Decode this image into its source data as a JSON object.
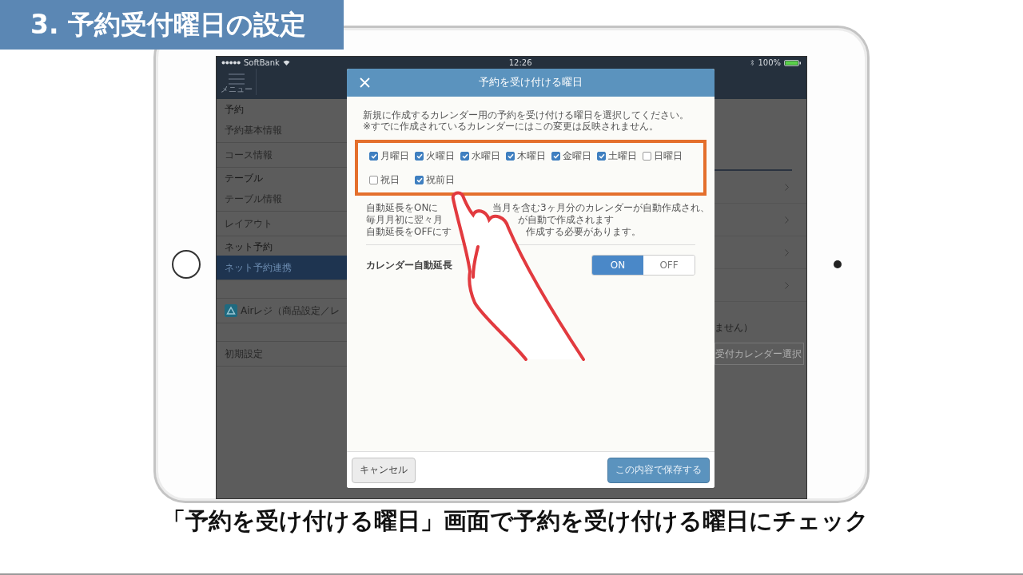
{
  "banner": {
    "title": "3. 予約受付曜日の設定"
  },
  "status_bar": {
    "carrier": "SoftBank",
    "time": "12:26",
    "battery": "100%"
  },
  "nav": {
    "menu_label": "メニュー"
  },
  "sidebar": {
    "items": [
      {
        "kind": "header",
        "label": "予約"
      },
      {
        "kind": "item",
        "label": "予約基本情報",
        "selected": false
      },
      {
        "kind": "item",
        "label": "コース情報",
        "selected": false
      },
      {
        "kind": "header",
        "label": "テーブル"
      },
      {
        "kind": "item",
        "label": "テーブル情報",
        "selected": false
      },
      {
        "kind": "item",
        "label": "レイアウト",
        "selected": false
      },
      {
        "kind": "header",
        "label": "ネット予約"
      },
      {
        "kind": "item",
        "label": "ネット予約連携",
        "selected": true
      },
      {
        "kind": "blank"
      },
      {
        "kind": "app",
        "label": "Airレジ（商品設定／レ",
        "selected": false
      },
      {
        "kind": "blank"
      },
      {
        "kind": "item",
        "label": "初期設定",
        "selected": false
      }
    ]
  },
  "dialog": {
    "title": "予約を受け付ける曜日",
    "description": [
      "新規に作成するカレンダー用の予約を受け付ける曜日を選択してください。",
      "※すでに作成されているカレンダーにはこの変更は反映されません。"
    ],
    "days": [
      {
        "label": "月曜日",
        "checked": true
      },
      {
        "label": "火曜日",
        "checked": true
      },
      {
        "label": "水曜日",
        "checked": true
      },
      {
        "label": "木曜日",
        "checked": true
      },
      {
        "label": "金曜日",
        "checked": true
      },
      {
        "label": "土曜日",
        "checked": true
      },
      {
        "label": "日曜日",
        "checked": false
      },
      {
        "label": "祝日",
        "checked": false
      },
      {
        "label": "祝前日",
        "checked": true
      }
    ],
    "notes": [
      [
        "自動延長をONに",
        "当月を含む3ヶ月分のカレンダーが自動作成され、"
      ],
      [
        "毎月月初に翌々月",
        "が自動で作成されます"
      ],
      [
        "自動延長をOFFにす",
        "作成する必要があります。"
      ]
    ],
    "setting": {
      "label": "カレンダー自動延長",
      "options": [
        {
          "label": "ON",
          "selected": true
        },
        {
          "label": "OFF",
          "selected": false
        }
      ]
    },
    "cancel": "キャンセル",
    "save": "この内容で保存する"
  },
  "background": {
    "note": "ません）",
    "button": "受付カレンダー選択"
  },
  "caption": "「予約を受け付ける曜日」画面で予約を受け付ける曜日にチェック"
}
